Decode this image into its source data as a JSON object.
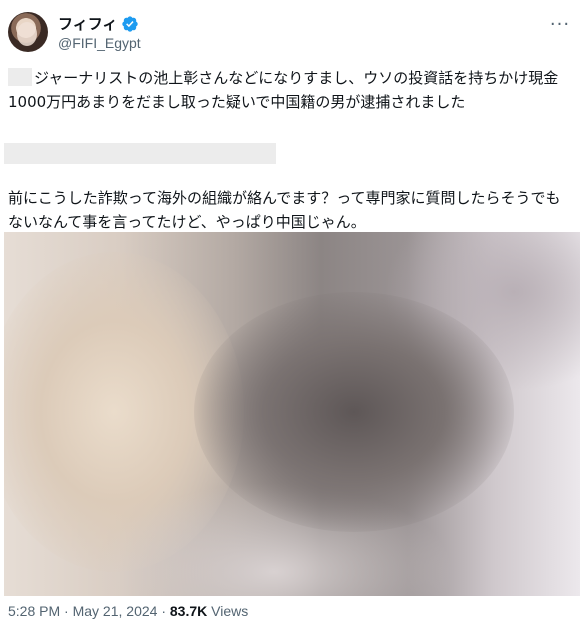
{
  "author": {
    "display_name": "フィフィ",
    "handle": "@FIFI_Egypt",
    "verified_icon": "verified-badge-icon",
    "accent_color": "#1d9bf0"
  },
  "menu_icon": "more-horizontal-icon",
  "tweet": {
    "paragraph1": "ジャーナリストの池上彰さんなどになりすまし、ウソの投資話を持ちかけ現金1000万円あまりをだまし取った疑いで中国籍の男が逮捕されました",
    "paragraph2": "前にこうした詐欺って海外の組織が絡んでます？って専門家に質問したらそうでもないなんて事を言ってたけど、やっぱり中国じゃん。"
  },
  "meta": {
    "time": "5:28 PM",
    "separator1": " · ",
    "date": "May 21, 2024",
    "separator2": " · ",
    "views_count": "83.7K",
    "views_label": " Views"
  }
}
